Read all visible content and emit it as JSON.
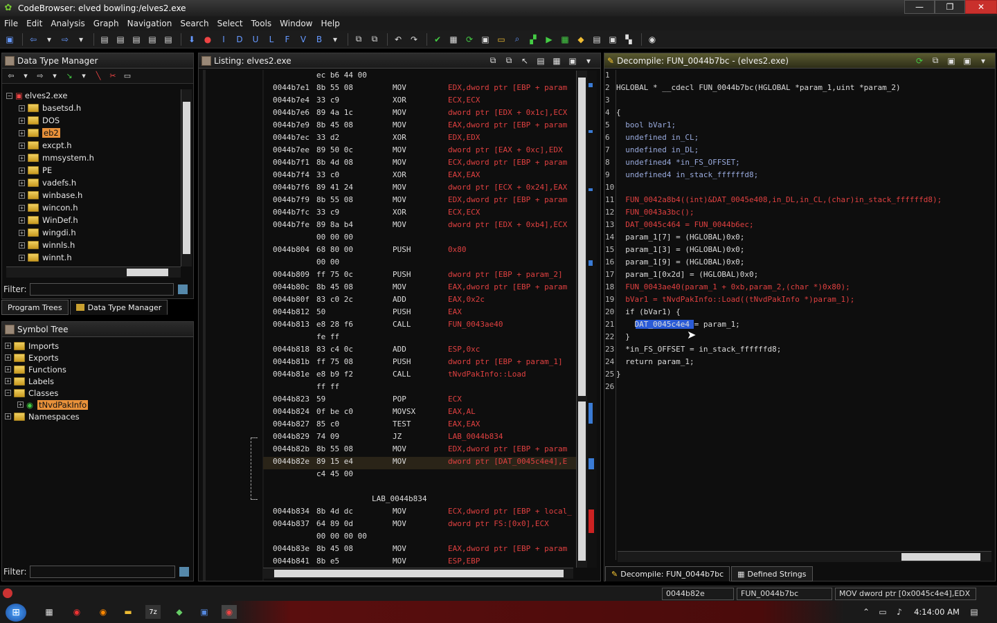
{
  "window": {
    "title": "CodeBrowser: elved bowling:/elves2.exe"
  },
  "menu": [
    "File",
    "Edit",
    "Analysis",
    "Graph",
    "Navigation",
    "Search",
    "Select",
    "Tools",
    "Window",
    "Help"
  ],
  "dtm": {
    "title": "Data Type Manager",
    "root": "elves2.exe",
    "items": [
      "basetsd.h",
      "DOS",
      "eb2",
      "excpt.h",
      "mmsystem.h",
      "PE",
      "vadefs.h",
      "winbase.h",
      "wincon.h",
      "WinDef.h",
      "wingdi.h",
      "winnls.h",
      "winnt.h"
    ],
    "filter_label": "Filter:",
    "tabs": [
      "Program Trees",
      "Data Type Manager"
    ]
  },
  "symtree": {
    "title": "Symbol Tree",
    "items": [
      "Imports",
      "Exports",
      "Functions",
      "Labels",
      "Classes",
      "tNvdPakInfo",
      "Namespaces"
    ],
    "filter_label": "Filter:"
  },
  "listing": {
    "title": "Listing:  elves2.exe",
    "rows": [
      {
        "a": "",
        "b": "ec b6 44 00",
        "m": "",
        "o": ""
      },
      {
        "a": "0044b7e1",
        "b": "8b 55 08",
        "m": "MOV",
        "o": "EDX,dword ptr [EBP + param"
      },
      {
        "a": "0044b7e4",
        "b": "33 c9",
        "m": "XOR",
        "o": "ECX,ECX"
      },
      {
        "a": "0044b7e6",
        "b": "89 4a 1c",
        "m": "MOV",
        "o": "dword ptr [EDX + 0x1c],ECX"
      },
      {
        "a": "0044b7e9",
        "b": "8b 45 08",
        "m": "MOV",
        "o": "EAX,dword ptr [EBP + param"
      },
      {
        "a": "0044b7ec",
        "b": "33 d2",
        "m": "XOR",
        "o": "EDX,EDX"
      },
      {
        "a": "0044b7ee",
        "b": "89 50 0c",
        "m": "MOV",
        "o": "dword ptr [EAX + 0xc],EDX"
      },
      {
        "a": "0044b7f1",
        "b": "8b 4d 08",
        "m": "MOV",
        "o": "ECX,dword ptr [EBP + param"
      },
      {
        "a": "0044b7f4",
        "b": "33 c0",
        "m": "XOR",
        "o": "EAX,EAX"
      },
      {
        "a": "0044b7f6",
        "b": "89 41 24",
        "m": "MOV",
        "o": "dword ptr [ECX + 0x24],EAX"
      },
      {
        "a": "0044b7f9",
        "b": "8b 55 08",
        "m": "MOV",
        "o": "EDX,dword ptr [EBP + param"
      },
      {
        "a": "0044b7fc",
        "b": "33 c9",
        "m": "XOR",
        "o": "ECX,ECX"
      },
      {
        "a": "0044b7fe",
        "b": "89 8a b4",
        "m": "MOV",
        "o": "dword ptr [EDX + 0xb4],ECX"
      },
      {
        "a": "",
        "b": "00 00 00",
        "m": "",
        "o": ""
      },
      {
        "a": "0044b804",
        "b": "68 80 00",
        "m": "PUSH",
        "o": "0x80"
      },
      {
        "a": "",
        "b": "00 00",
        "m": "",
        "o": ""
      },
      {
        "a": "0044b809",
        "b": "ff 75 0c",
        "m": "PUSH",
        "o": "dword ptr [EBP + param_2]"
      },
      {
        "a": "0044b80c",
        "b": "8b 45 08",
        "m": "MOV",
        "o": "EAX,dword ptr [EBP + param"
      },
      {
        "a": "0044b80f",
        "b": "83 c0 2c",
        "m": "ADD",
        "o": "EAX,0x2c"
      },
      {
        "a": "0044b812",
        "b": "50",
        "m": "PUSH",
        "o": "EAX"
      },
      {
        "a": "0044b813",
        "b": "e8 28 f6",
        "m": "CALL",
        "o": "FUN_0043ae40"
      },
      {
        "a": "",
        "b": "fe ff",
        "m": "",
        "o": ""
      },
      {
        "a": "0044b818",
        "b": "83 c4 0c",
        "m": "ADD",
        "o": "ESP,0xc"
      },
      {
        "a": "0044b81b",
        "b": "ff 75 08",
        "m": "PUSH",
        "o": "dword ptr [EBP + param_1]"
      },
      {
        "a": "0044b81e",
        "b": "e8 b9 f2",
        "m": "CALL",
        "o": "tNvdPakInfo::Load"
      },
      {
        "a": "",
        "b": "ff ff",
        "m": "",
        "o": ""
      },
      {
        "a": "0044b823",
        "b": "59",
        "m": "POP",
        "o": "ECX"
      },
      {
        "a": "0044b824",
        "b": "0f be c0",
        "m": "MOVSX",
        "o": "EAX,AL"
      },
      {
        "a": "0044b827",
        "b": "85 c0",
        "m": "TEST",
        "o": "EAX,EAX"
      },
      {
        "a": "0044b829",
        "b": "74 09",
        "m": "JZ",
        "o": "LAB_0044b834"
      },
      {
        "a": "0044b82b",
        "b": "8b 55 08",
        "m": "MOV",
        "o": "EDX,dword ptr [EBP + param"
      },
      {
        "a": "0044b82e",
        "b": "89 15 e4",
        "m": "MOV",
        "o": "dword ptr [DAT_0045c4e4],E"
      },
      {
        "a": "",
        "b": "c4 45 00",
        "m": "",
        "o": ""
      },
      {
        "a": "",
        "b": "",
        "m": "",
        "o": ""
      },
      {
        "a": "",
        "b": "",
        "m": "LAB_0044b834",
        "o": ""
      },
      {
        "a": "0044b834",
        "b": "8b 4d dc",
        "m": "MOV",
        "o": "ECX,dword ptr [EBP + local_"
      },
      {
        "a": "0044b837",
        "b": "64 89 0d",
        "m": "MOV",
        "o": "dword ptr FS:[0x0],ECX"
      },
      {
        "a": "",
        "b": "00 00 00 00",
        "m": "",
        "o": ""
      },
      {
        "a": "0044b83e",
        "b": "8b 45 08",
        "m": "MOV",
        "o": "EAX,dword ptr [EBP + param"
      },
      {
        "a": "0044b841",
        "b": "8b e5",
        "m": "MOV",
        "o": "ESP,EBP"
      }
    ]
  },
  "decompile": {
    "title": "Decompile: FUN_0044b7bc -  (elves2.exe)",
    "lines": [
      "",
      "HGLOBAL * __cdecl FUN_0044b7bc(HGLOBAL *param_1,uint *param_2)",
      "",
      "{",
      "  bool bVar1;",
      "  undefined in_CL;",
      "  undefined in_DL;",
      "  undefined4 *in_FS_OFFSET;",
      "  undefined4 in_stack_ffffffd8;",
      "",
      "  FUN_0042a8b4((int)&DAT_0045e408,in_DL,in_CL,(char)in_stack_ffffffd8);",
      "  FUN_0043a3bc();",
      "  DAT_0045c464 = FUN_0044b6ec;",
      "  param_1[7] = (HGLOBAL)0x0;",
      "  param_1[3] = (HGLOBAL)0x0;",
      "  param_1[9] = (HGLOBAL)0x0;",
      "  param_1[0x2d] = (HGLOBAL)0x0;",
      "  FUN_0043ae40(param_1 + 0xb,param_2,(char *)0x80);",
      "  bVar1 = tNvdPakInfo::Load((tNvdPakInfo *)param_1);",
      "  if (bVar1) {",
      "    DAT_0045c4e4 = param_1;",
      "  }",
      "  *in_FS_OFFSET = in_stack_ffffffd8;",
      "  return param_1;",
      "}",
      ""
    ],
    "tabs": [
      "Decompile: FUN_0044b7bc",
      "Defined Strings"
    ]
  },
  "status": {
    "addr": "0044b82e",
    "func": "FUN_0044b7bc",
    "instr": "MOV dword ptr [0x0045c4e4],EDX"
  },
  "taskbar": {
    "clock": "4:14:00 AM"
  },
  "colors": {
    "accent": "#e8913a",
    "highlight": "#2a5bd7",
    "op_red": "#e04040",
    "var_blue": "#5a9de0"
  }
}
